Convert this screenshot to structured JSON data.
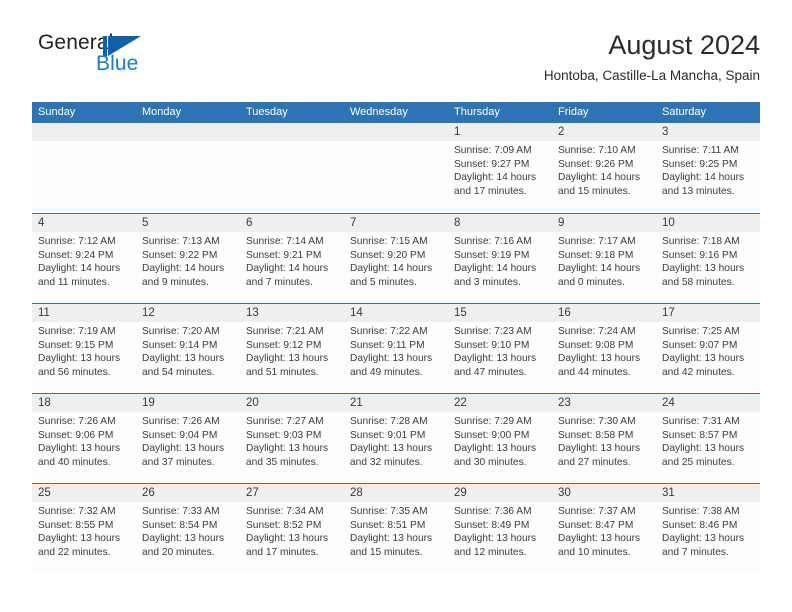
{
  "brand": {
    "word_one": "General",
    "word_two": "Blue",
    "mark_icon": "sailboat-triangle-icon",
    "accent_color": "#1f7cc4"
  },
  "header": {
    "title": "August 2024",
    "location": "Hontoba, Castille-La Mancha, Spain"
  },
  "theme": {
    "header_blue": "#2d74b4",
    "day_band_gray": "#efefef",
    "text": "#3c3c3c"
  },
  "calendar": {
    "weekday_headers": [
      "Sunday",
      "Monday",
      "Tuesday",
      "Wednesday",
      "Thursday",
      "Friday",
      "Saturday"
    ],
    "labels": {
      "sunrise": "Sunrise:",
      "sunset": "Sunset:",
      "daylight": "Daylight:"
    },
    "weeks": [
      [
        {
          "day": "",
          "empty": true
        },
        {
          "day": "",
          "empty": true
        },
        {
          "day": "",
          "empty": true
        },
        {
          "day": "",
          "empty": true
        },
        {
          "day": "1",
          "sunrise": "Sunrise: 7:09 AM",
          "sunset": "Sunset: 9:27 PM",
          "daylight_a": "Daylight: 14 hours",
          "daylight_b": "and 17 minutes."
        },
        {
          "day": "2",
          "sunrise": "Sunrise: 7:10 AM",
          "sunset": "Sunset: 9:26 PM",
          "daylight_a": "Daylight: 14 hours",
          "daylight_b": "and 15 minutes."
        },
        {
          "day": "3",
          "sunrise": "Sunrise: 7:11 AM",
          "sunset": "Sunset: 9:25 PM",
          "daylight_a": "Daylight: 14 hours",
          "daylight_b": "and 13 minutes."
        }
      ],
      [
        {
          "day": "4",
          "sunrise": "Sunrise: 7:12 AM",
          "sunset": "Sunset: 9:24 PM",
          "daylight_a": "Daylight: 14 hours",
          "daylight_b": "and 11 minutes."
        },
        {
          "day": "5",
          "sunrise": "Sunrise: 7:13 AM",
          "sunset": "Sunset: 9:22 PM",
          "daylight_a": "Daylight: 14 hours",
          "daylight_b": "and 9 minutes."
        },
        {
          "day": "6",
          "sunrise": "Sunrise: 7:14 AM",
          "sunset": "Sunset: 9:21 PM",
          "daylight_a": "Daylight: 14 hours",
          "daylight_b": "and 7 minutes."
        },
        {
          "day": "7",
          "sunrise": "Sunrise: 7:15 AM",
          "sunset": "Sunset: 9:20 PM",
          "daylight_a": "Daylight: 14 hours",
          "daylight_b": "and 5 minutes."
        },
        {
          "day": "8",
          "sunrise": "Sunrise: 7:16 AM",
          "sunset": "Sunset: 9:19 PM",
          "daylight_a": "Daylight: 14 hours",
          "daylight_b": "and 3 minutes."
        },
        {
          "day": "9",
          "sunrise": "Sunrise: 7:17 AM",
          "sunset": "Sunset: 9:18 PM",
          "daylight_a": "Daylight: 14 hours",
          "daylight_b": "and 0 minutes."
        },
        {
          "day": "10",
          "sunrise": "Sunrise: 7:18 AM",
          "sunset": "Sunset: 9:16 PM",
          "daylight_a": "Daylight: 13 hours",
          "daylight_b": "and 58 minutes."
        }
      ],
      [
        {
          "day": "11",
          "sunrise": "Sunrise: 7:19 AM",
          "sunset": "Sunset: 9:15 PM",
          "daylight_a": "Daylight: 13 hours",
          "daylight_b": "and 56 minutes."
        },
        {
          "day": "12",
          "sunrise": "Sunrise: 7:20 AM",
          "sunset": "Sunset: 9:14 PM",
          "daylight_a": "Daylight: 13 hours",
          "daylight_b": "and 54 minutes."
        },
        {
          "day": "13",
          "sunrise": "Sunrise: 7:21 AM",
          "sunset": "Sunset: 9:12 PM",
          "daylight_a": "Daylight: 13 hours",
          "daylight_b": "and 51 minutes."
        },
        {
          "day": "14",
          "sunrise": "Sunrise: 7:22 AM",
          "sunset": "Sunset: 9:11 PM",
          "daylight_a": "Daylight: 13 hours",
          "daylight_b": "and 49 minutes."
        },
        {
          "day": "15",
          "sunrise": "Sunrise: 7:23 AM",
          "sunset": "Sunset: 9:10 PM",
          "daylight_a": "Daylight: 13 hours",
          "daylight_b": "and 47 minutes."
        },
        {
          "day": "16",
          "sunrise": "Sunrise: 7:24 AM",
          "sunset": "Sunset: 9:08 PM",
          "daylight_a": "Daylight: 13 hours",
          "daylight_b": "and 44 minutes."
        },
        {
          "day": "17",
          "sunrise": "Sunrise: 7:25 AM",
          "sunset": "Sunset: 9:07 PM",
          "daylight_a": "Daylight: 13 hours",
          "daylight_b": "and 42 minutes."
        }
      ],
      [
        {
          "day": "18",
          "sunrise": "Sunrise: 7:26 AM",
          "sunset": "Sunset: 9:06 PM",
          "daylight_a": "Daylight: 13 hours",
          "daylight_b": "and 40 minutes."
        },
        {
          "day": "19",
          "sunrise": "Sunrise: 7:26 AM",
          "sunset": "Sunset: 9:04 PM",
          "daylight_a": "Daylight: 13 hours",
          "daylight_b": "and 37 minutes."
        },
        {
          "day": "20",
          "sunrise": "Sunrise: 7:27 AM",
          "sunset": "Sunset: 9:03 PM",
          "daylight_a": "Daylight: 13 hours",
          "daylight_b": "and 35 minutes."
        },
        {
          "day": "21",
          "sunrise": "Sunrise: 7:28 AM",
          "sunset": "Sunset: 9:01 PM",
          "daylight_a": "Daylight: 13 hours",
          "daylight_b": "and 32 minutes."
        },
        {
          "day": "22",
          "sunrise": "Sunrise: 7:29 AM",
          "sunset": "Sunset: 9:00 PM",
          "daylight_a": "Daylight: 13 hours",
          "daylight_b": "and 30 minutes."
        },
        {
          "day": "23",
          "sunrise": "Sunrise: 7:30 AM",
          "sunset": "Sunset: 8:58 PM",
          "daylight_a": "Daylight: 13 hours",
          "daylight_b": "and 27 minutes."
        },
        {
          "day": "24",
          "sunrise": "Sunrise: 7:31 AM",
          "sunset": "Sunset: 8:57 PM",
          "daylight_a": "Daylight: 13 hours",
          "daylight_b": "and 25 minutes."
        }
      ],
      [
        {
          "day": "25",
          "sunrise": "Sunrise: 7:32 AM",
          "sunset": "Sunset: 8:55 PM",
          "daylight_a": "Daylight: 13 hours",
          "daylight_b": "and 22 minutes."
        },
        {
          "day": "26",
          "sunrise": "Sunrise: 7:33 AM",
          "sunset": "Sunset: 8:54 PM",
          "daylight_a": "Daylight: 13 hours",
          "daylight_b": "and 20 minutes."
        },
        {
          "day": "27",
          "sunrise": "Sunrise: 7:34 AM",
          "sunset": "Sunset: 8:52 PM",
          "daylight_a": "Daylight: 13 hours",
          "daylight_b": "and 17 minutes."
        },
        {
          "day": "28",
          "sunrise": "Sunrise: 7:35 AM",
          "sunset": "Sunset: 8:51 PM",
          "daylight_a": "Daylight: 13 hours",
          "daylight_b": "and 15 minutes."
        },
        {
          "day": "29",
          "sunrise": "Sunrise: 7:36 AM",
          "sunset": "Sunset: 8:49 PM",
          "daylight_a": "Daylight: 13 hours",
          "daylight_b": "and 12 minutes."
        },
        {
          "day": "30",
          "sunrise": "Sunrise: 7:37 AM",
          "sunset": "Sunset: 8:47 PM",
          "daylight_a": "Daylight: 13 hours",
          "daylight_b": "and 10 minutes."
        },
        {
          "day": "31",
          "sunrise": "Sunrise: 7:38 AM",
          "sunset": "Sunset: 8:46 PM",
          "daylight_a": "Daylight: 13 hours",
          "daylight_b": "and 7 minutes."
        }
      ]
    ]
  }
}
